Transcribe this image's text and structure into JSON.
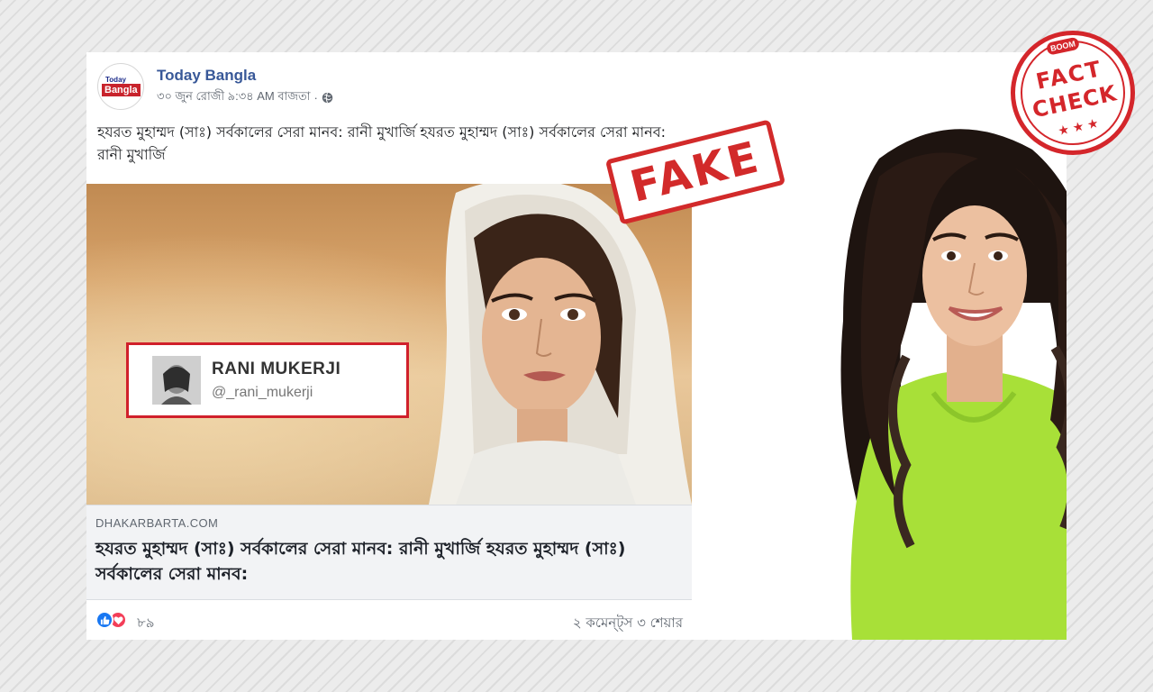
{
  "post": {
    "page_name": "Today Bangla",
    "logo": {
      "top_text": "Today",
      "bottom_text": "Bangla"
    },
    "timestamp": "৩০ জুন রোজী ৯:৩৪ AM বাজতা",
    "separator": "·",
    "privacy_icon": "globe-icon",
    "text": "হযরত মুহাম্মদ (সাঃ) সর্বকালের সেরা মানব: রানী মুখার্জি হযরত মুহাম্মদ (সাঃ) সর্বকালের সেরা মানব: রানী মুখার্জি",
    "twitter_card": {
      "name": "RANI MUKERJI",
      "handle": "@_rani_mukerji"
    },
    "link": {
      "domain": "DHAKARBARTA.COM",
      "title": "হযরত মুহাম্মদ (সাঃ) সর্বকালের সেরা মানব: রানী মুখার্জি হযরত মুহাম্মদ (সাঃ) সর্বকালের সেরা মানব:"
    },
    "reactions": {
      "icons": [
        "like-icon",
        "love-icon"
      ],
      "count": "৮৯"
    },
    "engagement": "২ কমেন্ট্স ৩ শেয়ার"
  },
  "stamp": {
    "text": "FAKE"
  },
  "badge": {
    "brand": "BOOM",
    "line1": "FACT",
    "line2": "CHECK",
    "stars": "★★★"
  },
  "colors": {
    "facebook_link": "#385898",
    "stamp_red": "#d22a2a",
    "sweater_green": "#a8e038",
    "like_blue": "#1877f2",
    "love_red": "#f33e58"
  }
}
